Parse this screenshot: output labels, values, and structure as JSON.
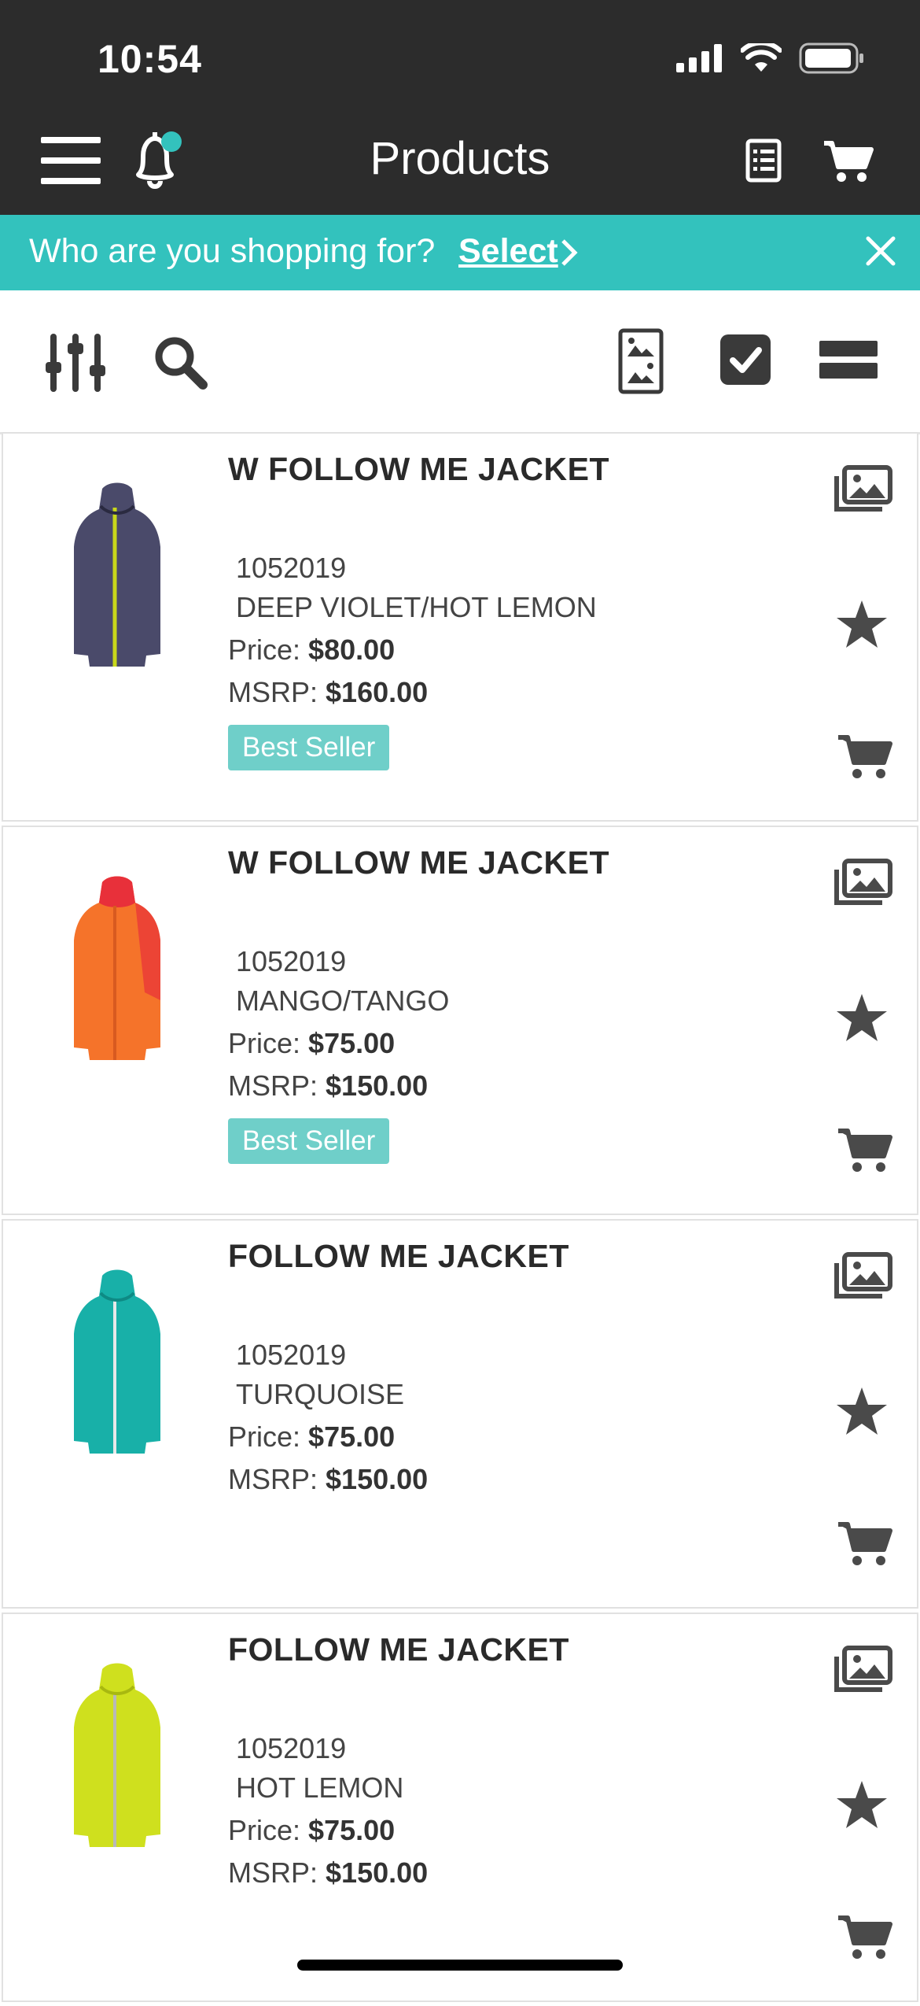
{
  "status_bar": {
    "time": "10:54"
  },
  "header": {
    "title": "Products"
  },
  "banner": {
    "question": "Who are you shopping for?",
    "select_label": "Select"
  },
  "products": [
    {
      "name": "W FOLLOW ME JACKET",
      "sku": "1052019",
      "color": "DEEP VIOLET/HOT LEMON",
      "price_label": "Price:",
      "price": "$80.00",
      "msrp_label": "MSRP:",
      "msrp": "$160.00",
      "badge": "Best Seller",
      "swatch": "#4a4a6a",
      "accent": "#c8d81a"
    },
    {
      "name": "W FOLLOW ME JACKET",
      "sku": "1052019",
      "color": "MANGO/TANGO",
      "price_label": "Price:",
      "price": "$75.00",
      "msrp_label": "MSRP:",
      "msrp": "$150.00",
      "badge": "Best Seller",
      "swatch": "#f5732a",
      "accent": "#e8303a"
    },
    {
      "name": "FOLLOW ME JACKET",
      "sku": "1052019",
      "color": "TURQUOISE",
      "price_label": "Price:",
      "price": "$75.00",
      "msrp_label": "MSRP:",
      "msrp": "$150.00",
      "badge": "",
      "swatch": "#18b0a8",
      "accent": "#e8e8e8"
    },
    {
      "name": "FOLLOW ME JACKET",
      "sku": "1052019",
      "color": "HOT LEMON",
      "price_label": "Price:",
      "price": "$75.00",
      "msrp_label": "MSRP:",
      "msrp": "$150.00",
      "badge": "",
      "swatch": "#cfe01e",
      "accent": "#b8b8b8"
    }
  ],
  "colors": {
    "header_bg": "#2c2c2c",
    "banner_bg": "#33c2bd",
    "badge_bg": "#6fcfc9",
    "notification_dot": "#33c2bd"
  }
}
